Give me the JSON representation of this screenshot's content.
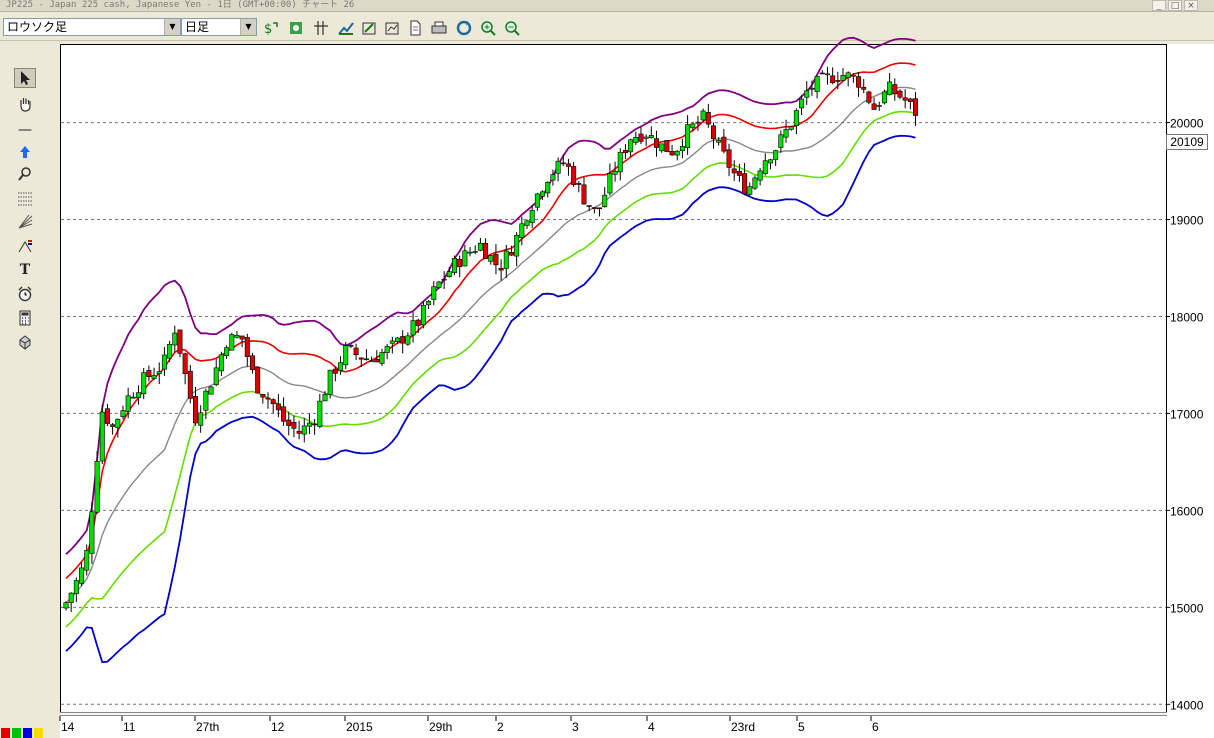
{
  "window": {
    "title": "JP225 - Japan 225 cash, Japanese Yen - 1日 (GMT+00:00)  チャート 26",
    "minimize_glyph": "_",
    "maximize_glyph": "□",
    "close_glyph": "×"
  },
  "toolbar": {
    "chart_type_value": "ロウソク足",
    "timeframe_value": "日足",
    "dropdown_arrow": "▼",
    "buttons": [
      "indicator-add-icon",
      "object-list-icon",
      "crosshair-icon",
      "chart-settings-icon",
      "edit-icon",
      "period-icon",
      "document-icon",
      "print-icon",
      "refresh-icon",
      "zoom-in-icon",
      "zoom-out-icon"
    ]
  },
  "palette": {
    "tools": [
      "cursor-icon",
      "hand-icon",
      "horizontal-line-icon",
      "arrow-up-icon",
      "magnifier-icon",
      "fibonacci-icon",
      "fan-icon",
      "pitchfork-icon",
      "text-icon",
      "alarm-clock-icon",
      "calculator-icon",
      "shapes-icon"
    ],
    "text_tool_glyph": "T",
    "line_tool_glyph": "—"
  },
  "chart_data": {
    "type": "candlestick",
    "symbol": "JP225",
    "current_price_label": "20109",
    "y_ticks": [
      "14000",
      "15000",
      "16000",
      "17000",
      "18000",
      "19000",
      "20000"
    ],
    "ylim": [
      13900,
      20800
    ],
    "x_labels": [
      "14",
      "11",
      "27th",
      "12",
      "2015",
      "29th",
      "2",
      "3",
      "4",
      "23rd",
      "5",
      "6"
    ],
    "grid": "horizontal dashed",
    "candles_count": 165,
    "key_closes": [
      [
        0,
        15050
      ],
      [
        6,
        15350
      ],
      [
        9,
        15600
      ],
      [
        12,
        16400
      ],
      [
        15,
        17050
      ],
      [
        19,
        16850
      ],
      [
        25,
        17150
      ],
      [
        32,
        17350
      ],
      [
        40,
        17500
      ],
      [
        45,
        17900
      ],
      [
        48,
        17500
      ],
      [
        53,
        16950
      ],
      [
        60,
        17350
      ],
      [
        66,
        17750
      ],
      [
        72,
        17800
      ],
      [
        78,
        17300
      ],
      [
        85,
        17100
      ],
      [
        90,
        16900
      ],
      [
        96,
        16800
      ],
      [
        102,
        16950
      ],
      [
        108,
        17350
      ],
      [
        115,
        17650
      ],
      [
        125,
        17550
      ],
      [
        135,
        17700
      ],
      [
        145,
        17950
      ],
      [
        152,
        18300
      ],
      [
        160,
        18550
      ],
      [
        170,
        18750
      ],
      [
        178,
        18500
      ],
      [
        184,
        18750
      ],
      [
        190,
        19100
      ],
      [
        198,
        19450
      ],
      [
        205,
        19600
      ],
      [
        212,
        19250
      ],
      [
        218,
        19050
      ],
      [
        225,
        19500
      ],
      [
        232,
        19850
      ],
      [
        238,
        19900
      ],
      [
        245,
        19750
      ],
      [
        250,
        19700
      ],
      [
        255,
        19900
      ],
      [
        262,
        20050
      ],
      [
        268,
        19750
      ],
      [
        275,
        19450
      ],
      [
        280,
        19300
      ],
      [
        286,
        19600
      ],
      [
        292,
        19750
      ],
      [
        298,
        20000
      ],
      [
        305,
        20350
      ],
      [
        312,
        20450
      ],
      [
        318,
        20500
      ],
      [
        325,
        20450
      ],
      [
        332,
        20150
      ],
      [
        338,
        20350
      ],
      [
        344,
        20250
      ],
      [
        349,
        20109
      ]
    ],
    "colors": {
      "bull": "#00dd00",
      "bear": "#dd0000",
      "bb_upper": "#800080",
      "bb_lower": "#0000cc",
      "ma_red": "#ee0000",
      "ma_gray": "#888888",
      "ma_green": "#66dd00",
      "grid": "#777777"
    }
  },
  "status": {
    "color_squares": [
      "#e00000",
      "#00c000",
      "#0000e0",
      "#ffd800"
    ]
  }
}
